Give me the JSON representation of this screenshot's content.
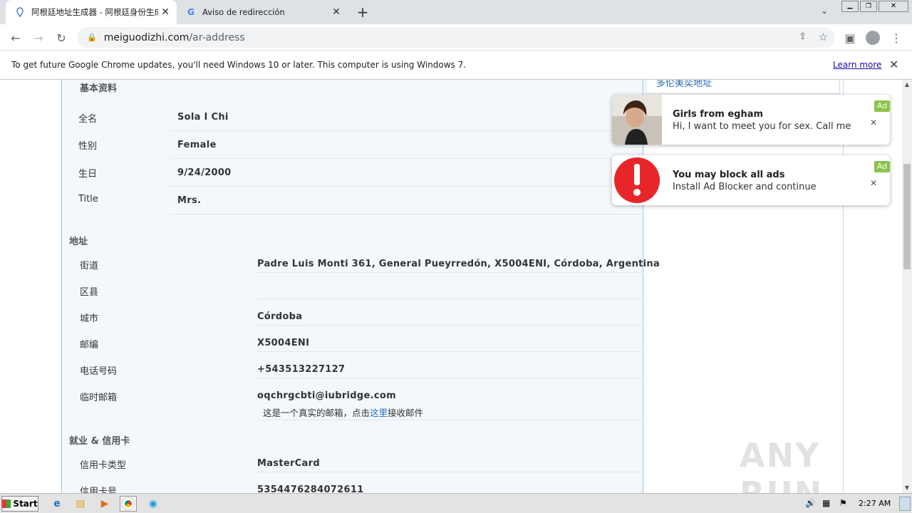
{
  "browser": {
    "tabs": [
      {
        "title": "阿根廷地址生成器 - 阿根廷身份生成",
        "favicon": "location-pin"
      },
      {
        "title": "Aviso de redirección",
        "favicon": "google-g"
      }
    ],
    "new_tab": "+",
    "url_host": "meiguodizhi.com",
    "url_path": "/ar-address"
  },
  "infobar": {
    "message": "To get future Google Chrome updates, you'll need Windows 10 or later. This computer is using Windows 7.",
    "learn_more": "Learn more"
  },
  "side": {
    "link": "多伦美奕地址"
  },
  "profile": {
    "basic": {
      "heading": "基本资料",
      "rows": [
        {
          "label": "全名",
          "value": "Sola I Chi"
        },
        {
          "label": "性别",
          "value": "Female"
        },
        {
          "label": "生日",
          "value": "9/24/2000"
        },
        {
          "label": "Title",
          "value": "Mrs."
        }
      ]
    },
    "address": {
      "heading": "地址",
      "rows": [
        {
          "label": "街道",
          "value": "Padre Luis Monti 361, General Pueyrredón, X5004ENI, Córdoba, Argentina"
        },
        {
          "label": "区县",
          "value": ""
        },
        {
          "label": "城市",
          "value": "Córdoba"
        },
        {
          "label": "邮编",
          "value": "X5004ENI"
        },
        {
          "label": "电话号码",
          "value": "+543513227127"
        },
        {
          "label": "临时邮箱",
          "value": "oqchrgcbti@iubridge.com"
        }
      ],
      "email_note_before": "这是一个真实的邮箱，点击",
      "email_note_link": "这里",
      "email_note_after": "接收邮件"
    },
    "employment": {
      "heading": "就业 & 信用卡",
      "rows": [
        {
          "label": "信用卡类型",
          "value": "MasterCard"
        },
        {
          "label": "信用卡号",
          "value": "5354476284072611"
        }
      ]
    }
  },
  "ads": [
    {
      "title": "Girls from egham",
      "body": "Hi, I want to meet you for sex. Call me",
      "tag": "Ad"
    },
    {
      "title": "You may block all ads",
      "body": "Install Ad Blocker and continue",
      "tag": "Ad"
    }
  ],
  "watermark": "ANY RUN",
  "taskbar": {
    "start": "Start",
    "clock": "2:27 AM"
  }
}
